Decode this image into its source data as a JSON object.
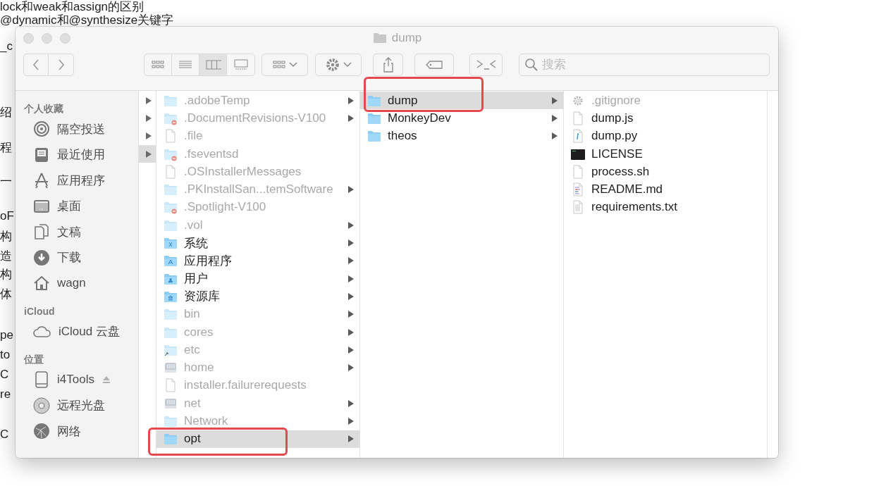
{
  "background_document": {
    "lines": [
      {
        "text": "lock和weak和assign的区别"
      },
      {
        "text": "@dynamic和@synthesize关键字"
      },
      {
        "text": "_c"
      },
      {
        "text": "绍"
      },
      {
        "text": "程"
      },
      {
        "text": "一"
      },
      {
        "text": "oF"
      },
      {
        "text": "构"
      },
      {
        "text": "造"
      },
      {
        "text": "构"
      },
      {
        "text": "体"
      },
      {
        "text": "pe"
      },
      {
        "text": "to"
      },
      {
        "text": "C"
      },
      {
        "text": "re"
      },
      {
        "text": "C"
      }
    ]
  },
  "window": {
    "title": "dump",
    "toolbar": {
      "view_modes": [
        {
          "kind": "icons",
          "selected": false
        },
        {
          "kind": "list",
          "selected": false
        },
        {
          "kind": "columns",
          "selected": true
        },
        {
          "kind": "gallery",
          "selected": false
        }
      ],
      "search": {
        "placeholder": "搜索"
      }
    },
    "sidebar": {
      "sections": [
        {
          "heading": "个人收藏",
          "items": [
            {
              "label": "隔空投送",
              "kind": "airdrop"
            },
            {
              "label": "最近使用",
              "kind": "recents"
            },
            {
              "label": "应用程序",
              "kind": "apps"
            },
            {
              "label": "桌面",
              "kind": "desktop"
            },
            {
              "label": "文稿",
              "kind": "documents"
            },
            {
              "label": "下载",
              "kind": "downloads"
            },
            {
              "label": "wagn",
              "kind": "home"
            }
          ]
        },
        {
          "heading": "iCloud",
          "items": [
            {
              "label": "iCloud 云盘",
              "kind": "cloud"
            }
          ]
        },
        {
          "heading": "位置",
          "items": [
            {
              "label": "i4Tools",
              "kind": "drive",
              "ejectable": true
            },
            {
              "label": "远程光盘",
              "kind": "disc"
            },
            {
              "label": "网络",
              "kind": "network"
            }
          ]
        }
      ]
    },
    "previous_column": {
      "rows": [
        {
          "selected": false
        },
        {
          "selected": false
        },
        {
          "selected": false
        },
        {
          "selected": true
        }
      ]
    },
    "columns": [
      {
        "rows": [
          {
            "name": ".adobeTemp",
            "kind": "folder",
            "dimmed": true,
            "has_children": true,
            "selected": false
          },
          {
            "name": ".DocumentRevisions-V100",
            "kind": "restricted-folder",
            "dimmed": true,
            "has_children": true,
            "selected": false
          },
          {
            "name": ".file",
            "kind": "file",
            "dimmed": true,
            "has_children": false,
            "selected": false
          },
          {
            "name": ".fseventsd",
            "kind": "restricted-folder",
            "dimmed": true,
            "has_children": false,
            "selected": false
          },
          {
            "name": ".OSInstallerMessages",
            "kind": "file",
            "dimmed": true,
            "has_children": false,
            "selected": false
          },
          {
            "name": ".PKInstallSan...temSoftware",
            "kind": "folder",
            "dimmed": true,
            "has_children": true,
            "selected": false
          },
          {
            "name": ".Spotlight-V100",
            "kind": "restricted-folder",
            "dimmed": true,
            "has_children": false,
            "selected": false
          },
          {
            "name": ".vol",
            "kind": "folder",
            "dimmed": true,
            "has_children": true,
            "selected": false
          },
          {
            "name": "系统",
            "kind": "system-folder",
            "dimmed": false,
            "has_children": true,
            "selected": false
          },
          {
            "name": "应用程序",
            "kind": "apps-folder",
            "dimmed": false,
            "has_children": true,
            "selected": false
          },
          {
            "name": "用户",
            "kind": "users-folder",
            "dimmed": false,
            "has_children": true,
            "selected": false
          },
          {
            "name": "资源库",
            "kind": "library-folder",
            "dimmed": false,
            "has_children": true,
            "selected": false
          },
          {
            "name": "bin",
            "kind": "folder",
            "dimmed": true,
            "has_children": true,
            "selected": false
          },
          {
            "name": "cores",
            "kind": "folder",
            "dimmed": true,
            "has_children": true,
            "selected": false
          },
          {
            "name": "etc",
            "kind": "alias-folder",
            "dimmed": true,
            "has_children": true,
            "selected": false
          },
          {
            "name": "home",
            "kind": "disk",
            "dimmed": true,
            "has_children": true,
            "selected": false
          },
          {
            "name": "installer.failurerequests",
            "kind": "file",
            "dimmed": true,
            "has_children": false,
            "selected": false
          },
          {
            "name": "net",
            "kind": "disk",
            "dimmed": true,
            "has_children": true,
            "selected": false
          },
          {
            "name": "Network",
            "kind": "folder",
            "dimmed": true,
            "has_children": true,
            "selected": false
          },
          {
            "name": "opt",
            "kind": "folder",
            "dimmed": false,
            "has_children": true,
            "selected": true,
            "annotated": true
          }
        ]
      },
      {
        "rows": [
          {
            "name": "dump",
            "kind": "folder",
            "dimmed": false,
            "has_children": true,
            "selected": true,
            "annotated": true
          },
          {
            "name": "MonkeyDev",
            "kind": "folder",
            "dimmed": false,
            "has_children": true,
            "selected": false
          },
          {
            "name": "theos",
            "kind": "folder",
            "dimmed": false,
            "has_children": true,
            "selected": false
          }
        ]
      },
      {
        "rows": [
          {
            "name": ".gitignore",
            "kind": "gear-file",
            "dimmed": true,
            "has_children": false,
            "selected": false
          },
          {
            "name": "dump.js",
            "kind": "file",
            "dimmed": false,
            "has_children": false,
            "selected": false
          },
          {
            "name": "dump.py",
            "kind": "python-file",
            "dimmed": false,
            "has_children": false,
            "selected": false
          },
          {
            "name": "LICENSE",
            "kind": "terminal-file",
            "dimmed": false,
            "has_children": false,
            "selected": false
          },
          {
            "name": "process.sh",
            "kind": "file",
            "dimmed": false,
            "has_children": false,
            "selected": false
          },
          {
            "name": "README.md",
            "kind": "markdown-file",
            "dimmed": false,
            "has_children": false,
            "selected": false
          },
          {
            "name": "requirements.txt",
            "kind": "text-file",
            "dimmed": false,
            "has_children": false,
            "selected": false
          }
        ]
      }
    ]
  }
}
